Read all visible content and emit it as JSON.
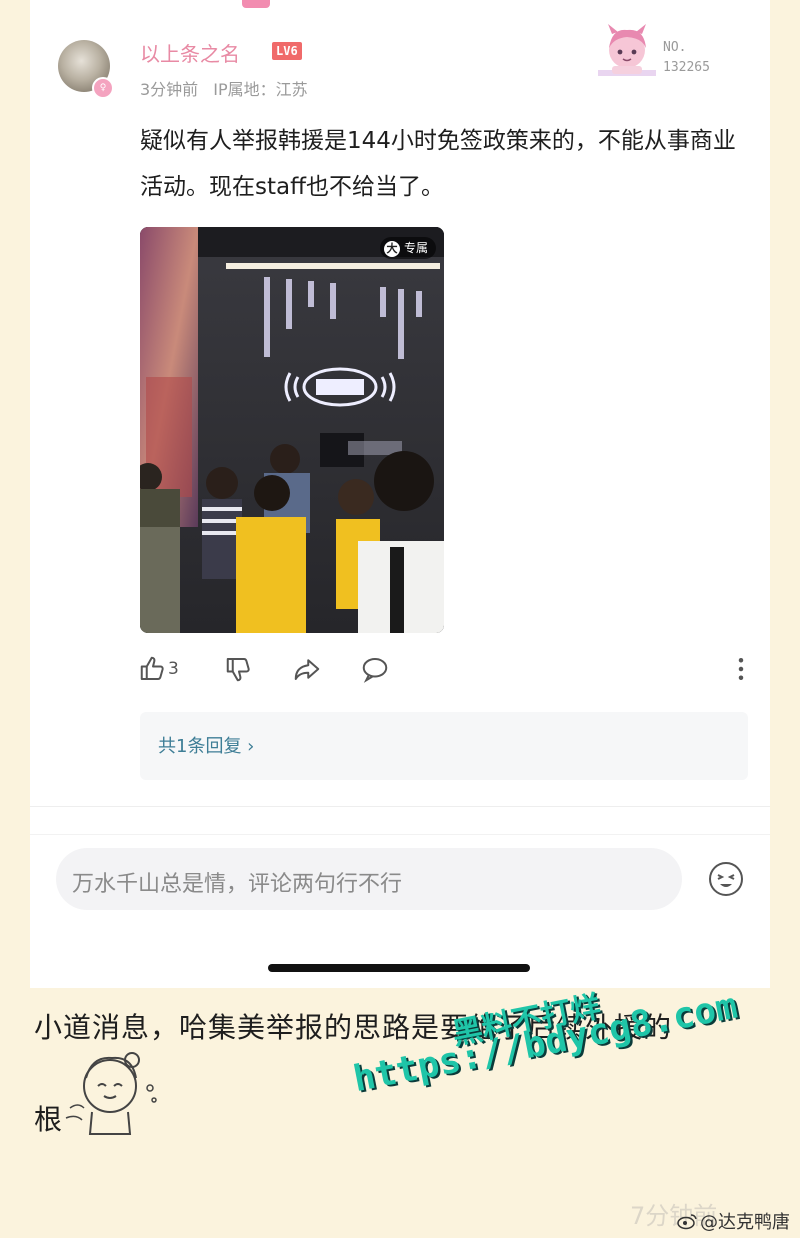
{
  "post": {
    "username": "以上条之名",
    "level": "LV6",
    "time": "3分钟前",
    "ip": "IP属地：江苏",
    "badge_label": "NO.",
    "badge_number": "132265",
    "text": "疑似有人举报韩援是144小时免签政策来的，不能从事商业活动。现在staff也不给当了。",
    "image_tag": "专属",
    "image_tag_icon": "大"
  },
  "actions": {
    "like_count": "3"
  },
  "replies": {
    "label": "共1条回复 ›"
  },
  "comment": {
    "placeholder": "万水千山总是情，评论两句行不行"
  },
  "caption": {
    "line1": "小道消息，哈集美举报的思路是要绝了后续外援的",
    "line2": "根"
  },
  "watermark": {
    "line1": "黑料不打烊",
    "line2": "https://bdycg8.com",
    "ghost_text": "7分钟前"
  },
  "credit": "@达克鸭唐",
  "colors": {
    "background": "#fbf3dd",
    "username": "#e88aa4",
    "level_badge": "#f06a6a",
    "link": "#3e7e96",
    "watermark": "#1fc5a8"
  }
}
